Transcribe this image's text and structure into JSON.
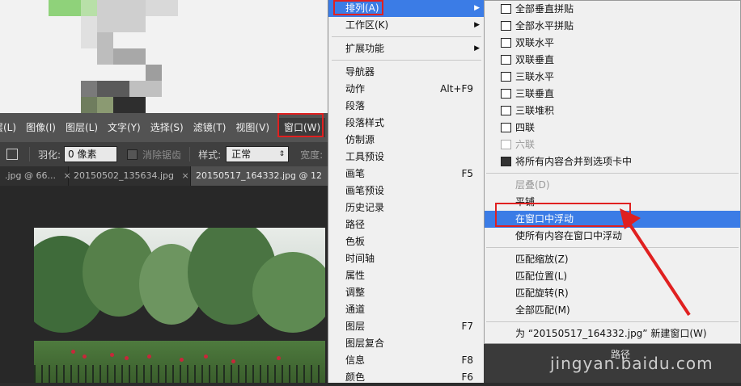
{
  "ps_menubar": {
    "items": [
      "层(L)",
      "图像(I)",
      "图层(L)",
      "文字(Y)",
      "选择(S)",
      "滤镜(T)",
      "视图(V)",
      "窗口(W)"
    ]
  },
  "ps_options": {
    "feather_label": "羽化:",
    "feather_value": "0 像素",
    "antialias_label": "消除锯齿",
    "style_label": "样式:",
    "style_value": "正常",
    "width_label": "宽度:"
  },
  "ps_tabs": [
    {
      "label": ".jpg @ 66...",
      "close": "×"
    },
    {
      "label": "20150502_135634.jpg",
      "close": "×"
    },
    {
      "label": "20150517_164332.jpg @ 12",
      "close": ""
    }
  ],
  "window_menu": {
    "items": [
      {
        "label": "排列(A)",
        "shortcut": "",
        "arrow": "▶"
      },
      {
        "label": "工作区(K)",
        "shortcut": "",
        "arrow": "▶"
      },
      {
        "label": "扩展功能",
        "shortcut": "",
        "arrow": "▶"
      },
      {
        "label": "导航器",
        "shortcut": ""
      },
      {
        "label": "动作",
        "shortcut": "Alt+F9"
      },
      {
        "label": "段落",
        "shortcut": ""
      },
      {
        "label": "段落样式",
        "shortcut": ""
      },
      {
        "label": "仿制源",
        "shortcut": ""
      },
      {
        "label": "工具预设",
        "shortcut": ""
      },
      {
        "label": "画笔",
        "shortcut": "F5"
      },
      {
        "label": "画笔预设",
        "shortcut": ""
      },
      {
        "label": "历史记录",
        "shortcut": ""
      },
      {
        "label": "路径",
        "shortcut": ""
      },
      {
        "label": "色板",
        "shortcut": ""
      },
      {
        "label": "时间轴",
        "shortcut": ""
      },
      {
        "label": "属性",
        "shortcut": ""
      },
      {
        "label": "调整",
        "shortcut": ""
      },
      {
        "label": "通道",
        "shortcut": ""
      },
      {
        "label": "图层",
        "shortcut": "F7"
      },
      {
        "label": "图层复合",
        "shortcut": ""
      },
      {
        "label": "信息",
        "shortcut": "F8"
      },
      {
        "label": "颜色",
        "shortcut": "F6"
      }
    ]
  },
  "arrange_submenu": {
    "items": [
      {
        "label": "全部垂直拼贴"
      },
      {
        "label": "全部水平拼贴"
      },
      {
        "label": "双联水平"
      },
      {
        "label": "双联垂直"
      },
      {
        "label": "三联水平"
      },
      {
        "label": "三联垂直"
      },
      {
        "label": "三联堆积"
      },
      {
        "label": "四联"
      },
      {
        "label": "六联"
      },
      {
        "label": "将所有内容合并到选项卡中"
      },
      {
        "label": "层叠(D)"
      },
      {
        "label": "平铺"
      },
      {
        "label": "在窗口中浮动"
      },
      {
        "label": "使所有内容在窗口中浮动"
      },
      {
        "label": "匹配缩放(Z)"
      },
      {
        "label": "匹配位置(L)"
      },
      {
        "label": "匹配旋转(R)"
      },
      {
        "label": "全部匹配(M)"
      },
      {
        "label": "为 “20150517_164332.jpg” 新建窗口(W)"
      }
    ]
  },
  "panel_label": "路径",
  "watermark": "jingyan.baidu.com",
  "colors": {
    "highlight": "#3b7ce6",
    "annotation_red": "#e02020"
  }
}
